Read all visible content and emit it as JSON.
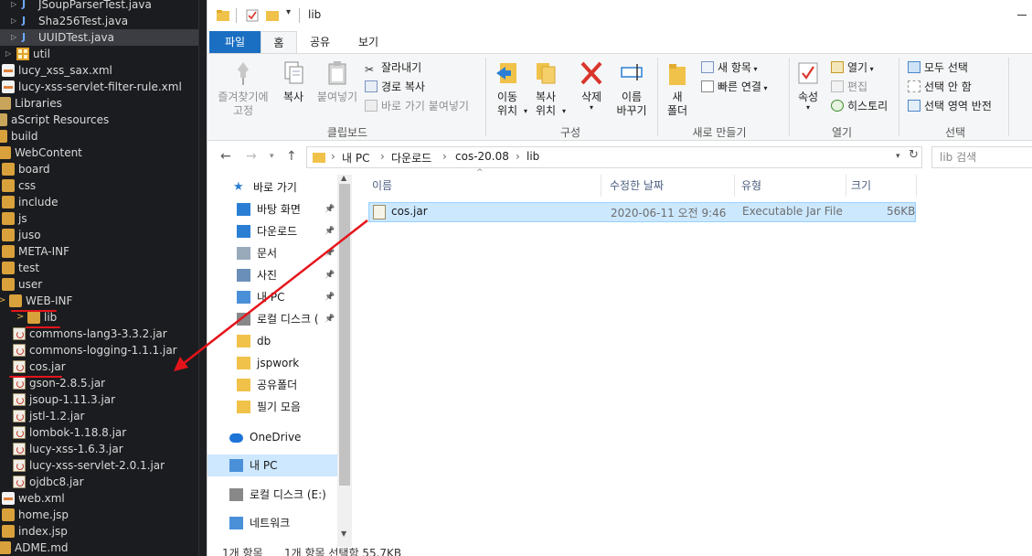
{
  "ide": {
    "tree": [
      {
        "label": "JSoupParserTest.java",
        "icon": "java-file-icon"
      },
      {
        "label": "Sha256Test.java",
        "icon": "java-file-icon"
      },
      {
        "label": "UUIDTest.java",
        "icon": "java-file-icon"
      },
      {
        "label": "util",
        "icon": "package-icon"
      },
      {
        "label": "lucy_xss_sax.xml",
        "icon": "xml-file-icon"
      },
      {
        "label": "lucy-xss-servlet-filter-rule.xml",
        "icon": "xml-file-icon"
      },
      {
        "label": "Libraries",
        "icon": "library-icon"
      },
      {
        "label": "aScript Resources",
        "icon": "library-icon"
      },
      {
        "label": "build",
        "icon": "folder-icon"
      },
      {
        "label": "WebContent",
        "icon": "folder-icon"
      },
      {
        "label": "board",
        "icon": "folder-icon"
      },
      {
        "label": "css",
        "icon": "folder-icon"
      },
      {
        "label": "include",
        "icon": "folder-icon"
      },
      {
        "label": "js",
        "icon": "folder-icon"
      },
      {
        "label": "juso",
        "icon": "folder-icon"
      },
      {
        "label": "META-INF",
        "icon": "folder-icon"
      },
      {
        "label": "test",
        "icon": "folder-icon"
      },
      {
        "label": "user",
        "icon": "folder-icon"
      },
      {
        "label": "WEB-INF",
        "icon": "folder-icon"
      },
      {
        "label": "lib",
        "icon": "folder-icon"
      },
      {
        "label": "commons-lang3-3.3.2.jar",
        "icon": "jar-file-icon"
      },
      {
        "label": "commons-logging-1.1.1.jar",
        "icon": "jar-file-icon"
      },
      {
        "label": "cos.jar",
        "icon": "jar-file-icon"
      },
      {
        "label": "gson-2.8.5.jar",
        "icon": "jar-file-icon"
      },
      {
        "label": "jsoup-1.11.3.jar",
        "icon": "jar-file-icon"
      },
      {
        "label": "jstl-1.2.jar",
        "icon": "jar-file-icon"
      },
      {
        "label": "lombok-1.18.8.jar",
        "icon": "jar-file-icon"
      },
      {
        "label": "lucy-xss-1.6.3.jar",
        "icon": "jar-file-icon"
      },
      {
        "label": "lucy-xss-servlet-2.0.1.jar",
        "icon": "jar-file-icon"
      },
      {
        "label": "ojdbc8.jar",
        "icon": "jar-file-icon"
      },
      {
        "label": "web.xml",
        "icon": "xml-file-icon"
      },
      {
        "label": "home.jsp",
        "icon": "jsp-file-icon"
      },
      {
        "label": "index.jsp",
        "icon": "jsp-file-icon"
      },
      {
        "label": "ADME.md",
        "icon": "md-file-icon"
      }
    ],
    "annotation_color": "#e5141b"
  },
  "explorer": {
    "title": "lib",
    "tabs": [
      "파일",
      "홈",
      "공유",
      "보기"
    ],
    "ribbon": {
      "clipboard": {
        "group": "클립보드",
        "pin": "즐겨찾기에\n고정",
        "copy": "복사",
        "paste": "붙여넣기",
        "cut": "잘라내기",
        "copy_path": "경로 복사",
        "paste_shortcut": "바로 가기 붙여넣기"
      },
      "organize": {
        "group": "구성",
        "move_to": "이동\n위치",
        "copy_to": "복사\n위치",
        "delete": "삭제",
        "rename": "이름\n바꾸기"
      },
      "new": {
        "group": "새로 만들기",
        "new_folder": "새\n폴더",
        "new_item": "새 항목",
        "easy_access": "빠른 연결"
      },
      "open": {
        "group": "열기",
        "properties": "속성",
        "open": "열기",
        "edit": "편집",
        "history": "히스토리"
      },
      "select": {
        "group": "선택",
        "select_all": "모두 선택",
        "select_none": "선택 안 함",
        "invert": "선택 영역 반전"
      }
    },
    "address": {
      "crumbs": [
        "내 PC",
        "다운로드",
        "cos-20.08",
        "lib"
      ],
      "search_placeholder": "lib 검색"
    },
    "nav": [
      {
        "label": "바로 가기",
        "icon": "star-icon",
        "pinned": false
      },
      {
        "label": "바탕 화면",
        "icon": "desktop-icon",
        "pinned": true
      },
      {
        "label": "다운로드",
        "icon": "download-icon",
        "pinned": true
      },
      {
        "label": "문서",
        "icon": "document-icon",
        "pinned": true
      },
      {
        "label": "사진",
        "icon": "picture-icon",
        "pinned": true
      },
      {
        "label": "내 PC",
        "icon": "pc-icon",
        "pinned": true
      },
      {
        "label": "로컬 디스크 (",
        "icon": "drive-icon",
        "pinned": true
      },
      {
        "label": "db",
        "icon": "folder-icon",
        "pinned": false
      },
      {
        "label": "jspwork",
        "icon": "folder-icon",
        "pinned": false
      },
      {
        "label": "공유폴더",
        "icon": "shared-folder-icon",
        "pinned": false
      },
      {
        "label": "필기 모음",
        "icon": "folder-icon",
        "pinned": false
      },
      {
        "label": "OneDrive",
        "icon": "cloud-icon",
        "pinned": false
      },
      {
        "label": "내 PC",
        "icon": "pc-icon",
        "pinned": false
      },
      {
        "label": "로컬 디스크 (E:)",
        "icon": "drive-icon",
        "pinned": false
      },
      {
        "label": "네트워크",
        "icon": "network-icon",
        "pinned": false
      }
    ],
    "columns": [
      "이름",
      "수정한 날짜",
      "유형",
      "크기"
    ],
    "files": [
      {
        "name": "cos.jar",
        "modified": "2020-06-11 오전 9:46",
        "type": "Executable Jar File",
        "size": "56KB"
      }
    ],
    "status": {
      "count": "1개 항목",
      "selected": "1개 항목 선택함 55.7KB"
    }
  }
}
